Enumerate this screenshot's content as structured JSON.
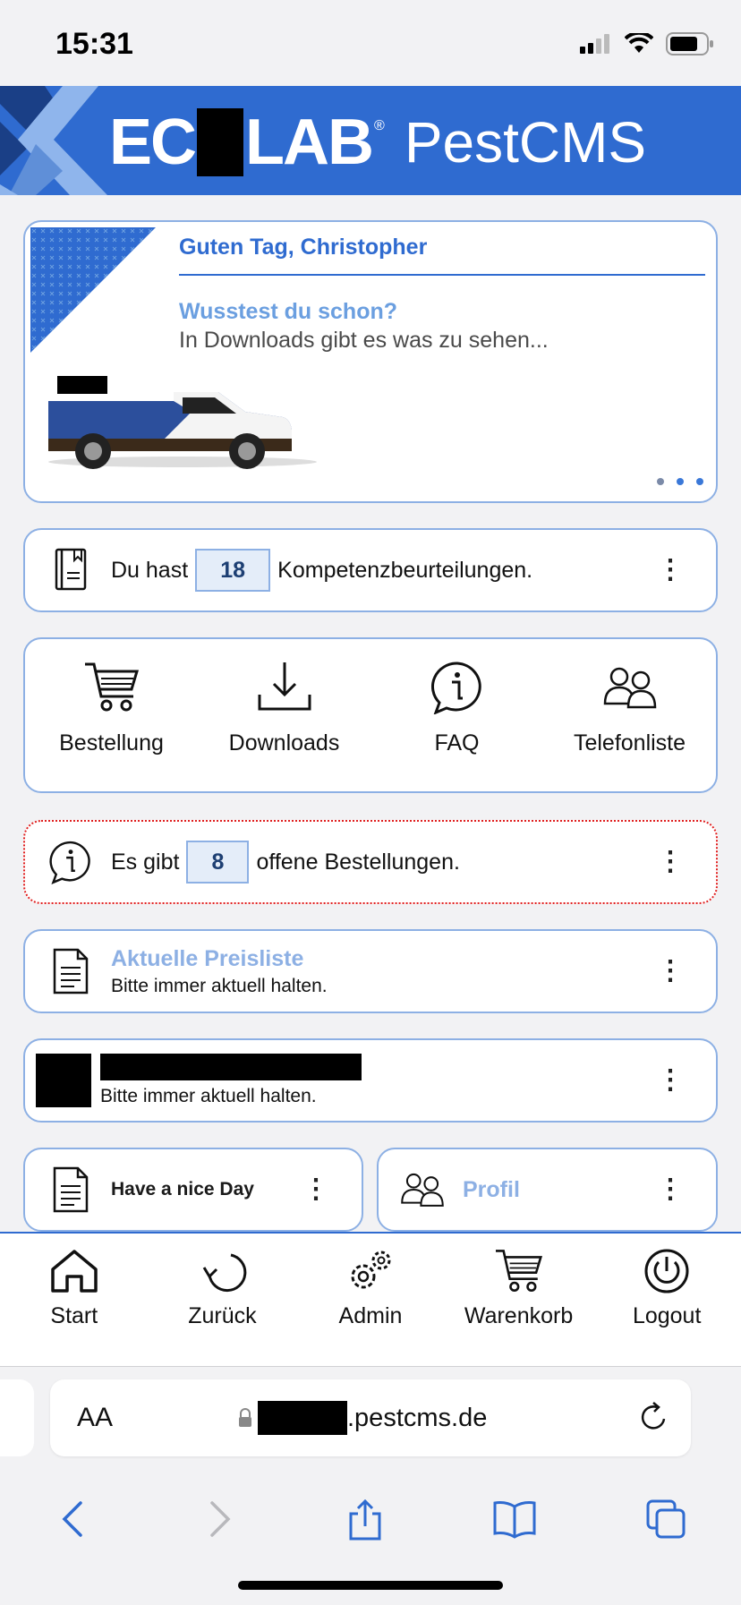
{
  "status": {
    "time": "15:31"
  },
  "header": {
    "brand_left": "EC",
    "brand_right": "LAB",
    "brand_product": "PestCMS",
    "reg": "®"
  },
  "hero": {
    "greeting": "Guten Tag, Christopher",
    "tip_title": "Wusstest du schon?",
    "tip_text": "In Downloads gibt es was zu sehen...",
    "slide_count": 3,
    "active_slide": 3
  },
  "competence": {
    "prefix": "Du hast",
    "count": "18",
    "suffix": "Kompetenzbeurteilungen."
  },
  "tiles": [
    {
      "label": "Bestellung",
      "icon": "cart-icon"
    },
    {
      "label": "Downloads",
      "icon": "download-icon"
    },
    {
      "label": "FAQ",
      "icon": "info-bubble-icon"
    },
    {
      "label": "Telefonliste",
      "icon": "people-icon"
    }
  ],
  "orders": {
    "prefix": "Es gibt",
    "count": "8",
    "suffix": "offene Bestellungen."
  },
  "pricelist": {
    "title": "Aktuelle Preisliste",
    "subtitle": "Bitte immer aktuell halten."
  },
  "redacted_item": {
    "subtitle": "Bitte immer aktuell halten."
  },
  "nice_day": {
    "label": "Have a nice Day"
  },
  "profil": {
    "label": "Profil"
  },
  "bottom_nav": [
    {
      "label": "Start",
      "icon": "home-icon"
    },
    {
      "label": "Zurück",
      "icon": "back-arrow-icon"
    },
    {
      "label": "Admin",
      "icon": "gears-icon"
    },
    {
      "label": "Warenkorb",
      "icon": "cart-icon"
    },
    {
      "label": "Logout",
      "icon": "power-icon"
    }
  ],
  "browser": {
    "aa_label": "AA",
    "domain": ".pestcms.de"
  },
  "colors": {
    "brand": "#2f6bd0",
    "card_border": "#8db0e4",
    "alert_border": "#e02020",
    "badge_bg": "#e4edf9"
  }
}
